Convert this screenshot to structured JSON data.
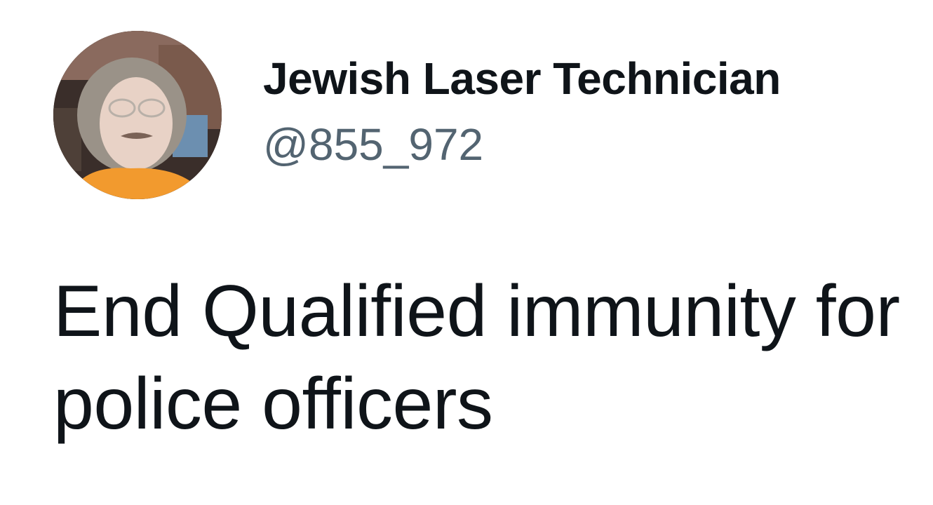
{
  "author": {
    "display_name": "Jewish Laser Technician",
    "handle": "@855_972",
    "avatar_icon": "profile-photo"
  },
  "tweet": {
    "text": "End Qualified immunity for police officers"
  },
  "colors": {
    "text_primary": "#0f1419",
    "text_secondary": "#536471",
    "background": "#ffffff"
  }
}
